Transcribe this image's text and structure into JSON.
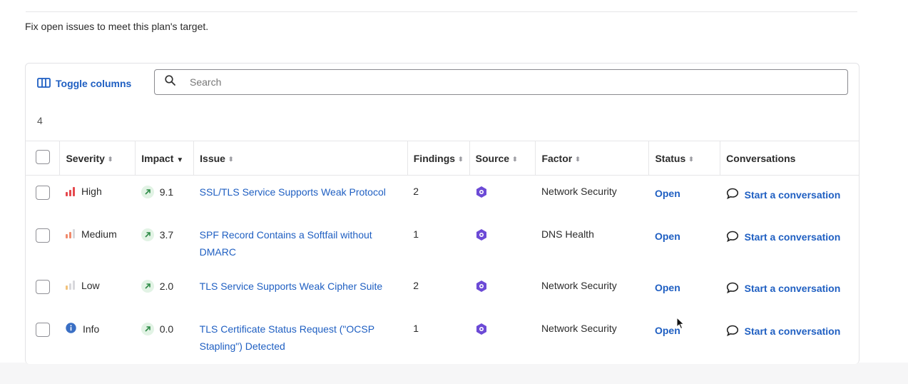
{
  "intro_text": "Fix open issues to meet this plan's target.",
  "toolbar": {
    "toggle_columns_label": "Toggle columns",
    "search_placeholder": "Search"
  },
  "result_count": "4",
  "columns": {
    "severity": "Severity",
    "impact": "Impact",
    "issue": "Issue",
    "findings": "Findings",
    "source": "Source",
    "factor": "Factor",
    "status": "Status",
    "conversations": "Conversations"
  },
  "colors": {
    "accent": "#1f5fc2",
    "high": "#e5484d",
    "medium": "#f08a6c",
    "low": "#f2c27a",
    "info": "#3a6fc4",
    "source_logo": "#6c4ad6"
  },
  "rows": [
    {
      "severity": "High",
      "severity_icon": "signal-bars-high-icon",
      "impact": "9.1",
      "issue": "SSL/TLS Service Supports Weak Protocol",
      "findings": "2",
      "source_icon": "source-logo-icon",
      "factor": "Network Security",
      "status": "Open",
      "conversation": "Start a conversation"
    },
    {
      "severity": "Medium",
      "severity_icon": "signal-bars-medium-icon",
      "impact": "3.7",
      "issue": "SPF Record Contains a Softfail without DMARC",
      "findings": "1",
      "source_icon": "source-logo-icon",
      "factor": "DNS Health",
      "status": "Open",
      "conversation": "Start a conversation"
    },
    {
      "severity": "Low",
      "severity_icon": "signal-bars-low-icon",
      "impact": "2.0",
      "issue": "TLS Service Supports Weak Cipher Suite",
      "findings": "2",
      "source_icon": "source-logo-icon",
      "factor": "Network Security",
      "status": "Open",
      "conversation": "Start a conversation"
    },
    {
      "severity": "Info",
      "severity_icon": "info-circle-icon",
      "impact": "0.0",
      "issue": "TLS Certificate Status Request (\"OCSP Stapling\") Detected",
      "findings": "1",
      "source_icon": "source-logo-icon",
      "factor": "Network Security",
      "status": "Open",
      "conversation": "Start a conversation"
    }
  ]
}
